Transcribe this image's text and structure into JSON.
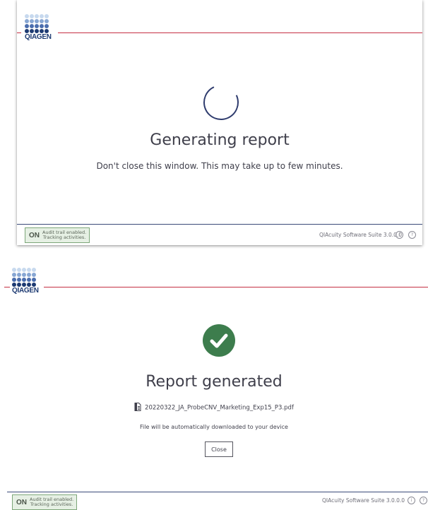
{
  "brand": {
    "name": "QIAGEN",
    "dot_colors": {
      "top": "#bcd3ec",
      "middle": "#6f92c8",
      "bottom": "#1d3a72"
    },
    "accent_line": "#c53044"
  },
  "generating": {
    "title": "Generating report",
    "subtitle": "Don't close this window. This may take up to few minutes."
  },
  "generated": {
    "title": "Report generated",
    "filename": "20220322_JA_ProbeCNV_Marketing_Exp15_P3.pdf",
    "auto_download": "File will be automatically downloaded to your device",
    "close_label": "Close",
    "status_color": "#3d7d4d"
  },
  "footer": {
    "audit_on": "ON",
    "audit_line1": "Audit trail enabled.",
    "audit_line2": "Tracking activities.",
    "version": "QIAcuity Software Suite 3.0.0.0",
    "info_icon": "i",
    "help_icon": "?"
  }
}
